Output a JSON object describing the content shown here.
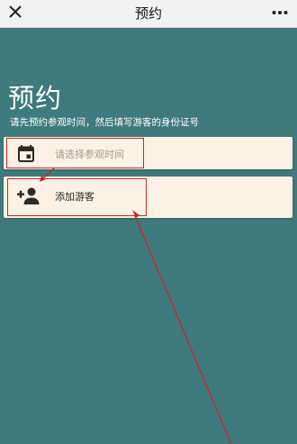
{
  "nav": {
    "title": "预约",
    "close_icon": "close-icon",
    "more_icon": "more-icon"
  },
  "header": {
    "title": "预约",
    "subtitle": "请先预约参观时间，然后填写游客的身份证号"
  },
  "date_field": {
    "icon": "calendar-icon",
    "placeholder": "请选择参观时间"
  },
  "add_visitor": {
    "icon": "add-person-icon",
    "label": "添加游客"
  },
  "colors": {
    "background": "#3f7a7c",
    "card": "#fcf1e4",
    "annotation": "#c0282c"
  }
}
